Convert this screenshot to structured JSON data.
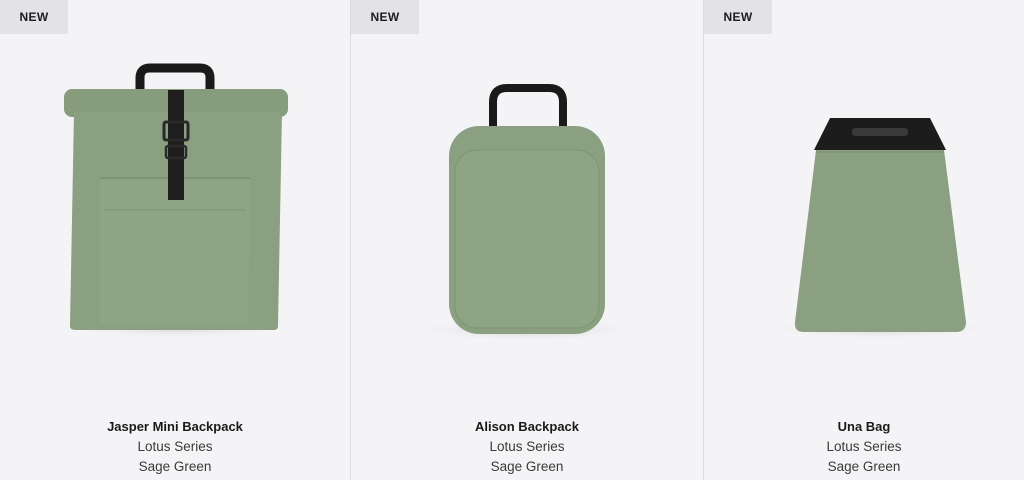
{
  "products": [
    {
      "badge": "NEW",
      "name": "Jasper Mini Backpack",
      "series": "Lotus Series",
      "color": "Sage Green"
    },
    {
      "badge": "NEW",
      "name": "Alison Backpack",
      "series": "Lotus Series",
      "color": "Sage Green"
    },
    {
      "badge": "NEW",
      "name": "Una Bag",
      "series": "Lotus Series",
      "color": "Sage Green"
    }
  ],
  "colors": {
    "background": "#f4f4f6",
    "badge_bg": "#e3e3e7",
    "sage_green": "#8a9e80",
    "strap": "#1a1a1a"
  },
  "images": [
    "jasper-mini-backpack-image",
    "alison-backpack-image",
    "una-bag-image"
  ]
}
